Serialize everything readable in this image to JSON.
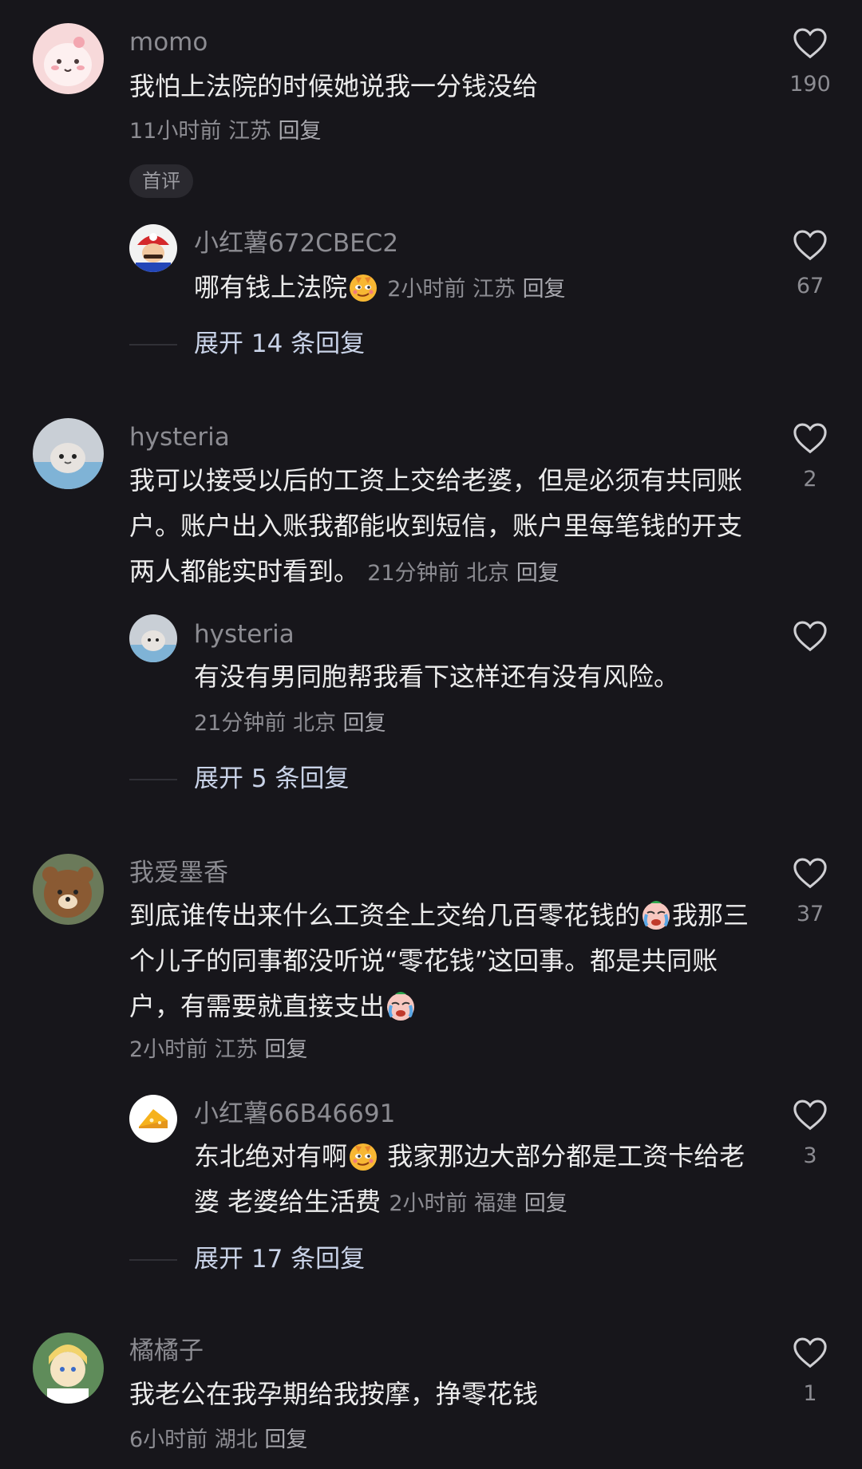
{
  "comments": [
    {
      "username": "momo",
      "text": "我怕上法院的时候她说我一分钱没给",
      "time": "11小时前",
      "location": "江苏",
      "reply_label": "回复",
      "likes": "190",
      "badge": "首评",
      "replies": [
        {
          "username": "小红薯672CBEC2",
          "text": "哪有钱上法院",
          "emoji": "smirk-face-emoji",
          "time": "2小时前",
          "location": "江苏",
          "reply_label": "回复",
          "likes": "67"
        }
      ],
      "expand_label": "展开 14 条回复"
    },
    {
      "username": "hysteria",
      "text": "我可以接受以后的工资上交给老婆，但是必须有共同账户。账户出入账我都能收到短信，账户里每笔钱的开支两人都能实时看到。",
      "time": "21分钟前",
      "location": "北京",
      "reply_label": "回复",
      "likes": "2",
      "replies": [
        {
          "username": "hysteria",
          "text": "有没有男同胞帮我看下这样还有没有风险。",
          "time": "21分钟前",
          "location": "北京",
          "reply_label": "回复",
          "likes": ""
        }
      ],
      "expand_label": "展开 5 条回复"
    },
    {
      "username": "我爱墨香",
      "text_parts": [
        "到底谁传出来什么工资全上交给几百零花钱的",
        "我那三个儿子的同事都没听说“零花钱”这回事。都是共同账户，有需要就直接支出"
      ],
      "emoji": "crying-face-emoji",
      "time": "2小时前",
      "location": "江苏",
      "reply_label": "回复",
      "likes": "37",
      "replies": [
        {
          "username": "小红薯66B46691",
          "text_parts": [
            "东北绝对有啊",
            " 我家那边大部分都是工资卡给老婆 老婆给生活费"
          ],
          "emoji": "smirk-face-emoji",
          "time": "2小时前",
          "location": "福建",
          "reply_label": "回复",
          "likes": "3"
        }
      ],
      "expand_label": "展开 17 条回复"
    },
    {
      "username": "橘橘子",
      "text": "我老公在我孕期给我按摩，挣零花钱",
      "time": "6小时前",
      "location": "湖北",
      "reply_label": "回复",
      "likes": "1"
    }
  ],
  "colors": {
    "background": "#17161b",
    "text": "#ececec",
    "muted": "#8c8c92",
    "expand": "#c9d3e8"
  }
}
